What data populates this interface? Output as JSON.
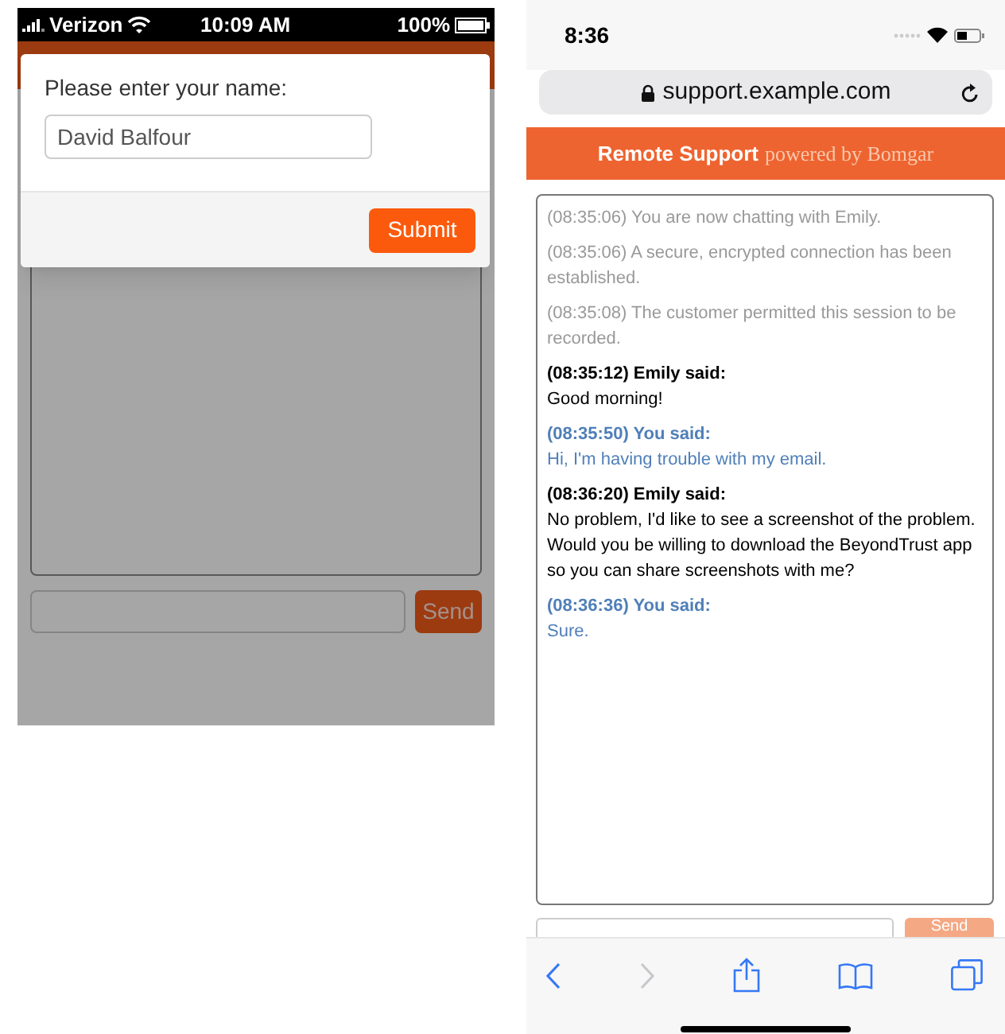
{
  "left_screen": {
    "status_bar": {
      "carrier": "Verizon",
      "time": "10:09 AM",
      "battery": "100%"
    },
    "dialog": {
      "prompt": "Please enter your name:",
      "name_field": {
        "value": "David Balfour"
      },
      "submit_button": "Submit"
    },
    "chat": {
      "send_button": "Send"
    }
  },
  "right_screen": {
    "status_bar": {
      "time": "8:36"
    },
    "address_bar": {
      "url": "support.example.com"
    },
    "header": {
      "title": "Remote Support",
      "subtitle": "powered by Bomgar"
    },
    "messages": [
      {
        "kind": "system",
        "text": "(08:35:06) You are now chatting with Emily."
      },
      {
        "kind": "system",
        "text": "(08:35:06) A secure, encrypted connection has been established."
      },
      {
        "kind": "system",
        "text": "(08:35:08) The customer permitted this session to be recorded."
      },
      {
        "kind": "agent",
        "header": "(08:35:12) Emily said:",
        "text": "Good morning!"
      },
      {
        "kind": "customer",
        "header": "(08:35:50) You said:",
        "text": "Hi, I'm having trouble with my email."
      },
      {
        "kind": "agent",
        "header": "(08:36:20) Emily said:",
        "text": "No problem, I'd like to see a screenshot of the problem. Would you be willing to download the BeyondTrust app so you can share screenshots with me?"
      },
      {
        "kind": "customer",
        "header": "(08:36:36) You said:",
        "text": "Sure."
      }
    ],
    "send_button": "Send"
  }
}
